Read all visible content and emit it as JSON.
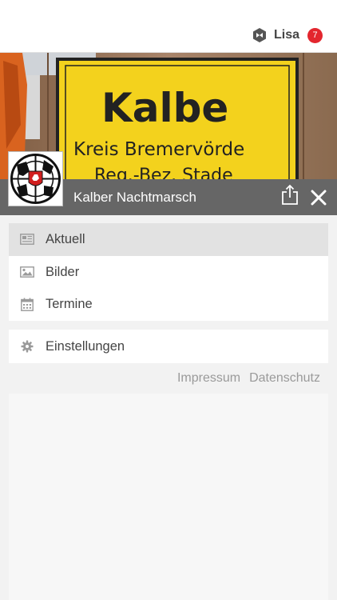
{
  "header": {
    "user_name": "Lisa",
    "notification_count": "7",
    "user_icon": "hexagon-logo-icon",
    "badge_color": "#e3262e"
  },
  "hero": {
    "sign_line1": "Kalbe",
    "sign_line2": "Kreis Bremervörde",
    "sign_line3": "Reg.-Bez. Stade",
    "sign_color": "#f3d21d"
  },
  "group": {
    "name": "Kalber Nachtmarsch",
    "bar_color": "#666666"
  },
  "menu": {
    "items": [
      {
        "label": "Aktuell",
        "icon": "newspaper-icon",
        "active": true
      },
      {
        "label": "Bilder",
        "icon": "image-icon",
        "active": false
      },
      {
        "label": "Termine",
        "icon": "calendar-icon",
        "active": false
      }
    ],
    "settings": {
      "label": "Einstellungen",
      "icon": "gear-icon"
    }
  },
  "footer": {
    "impressum": "Impressum",
    "datenschutz": "Datenschutz"
  }
}
